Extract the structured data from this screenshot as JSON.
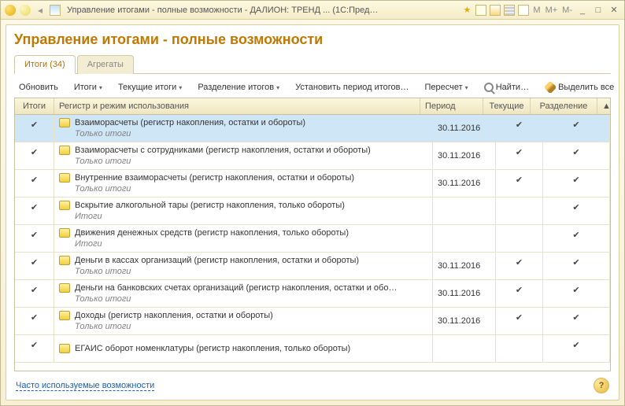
{
  "window_title": "Управление итогами - полные возможности - ДАЛИОН: ТРЕНД ... (1С:Предприятие)",
  "page_title": "Управление итогами - полные возможности",
  "tabs": [
    {
      "label": "Итоги (34)",
      "active": true
    },
    {
      "label": "Агрегаты",
      "active": false
    }
  ],
  "toolbar": {
    "refresh": "Обновить",
    "itogi": "Итоги",
    "current": "Текущие итоги",
    "split": "Разделение итогов",
    "set_period": "Установить период итогов…",
    "recalc": "Пересчет",
    "find": "Найти…",
    "select_all": "Выделить все"
  },
  "headers": {
    "itogi": "Итоги",
    "register": "Регистр и режим использования",
    "period": "Период",
    "current": "Текущие",
    "split": "Разделение"
  },
  "rows": [
    {
      "selected": true,
      "itogi": true,
      "name": "Взаиморасчеты (регистр накопления, остатки и обороты)",
      "mode": "Только итоги",
      "period": "30.11.2016",
      "current": true,
      "split": true
    },
    {
      "selected": false,
      "itogi": true,
      "name": "Взаиморасчеты с сотрудниками (регистр накопления, остатки и обороты)",
      "mode": "Только итоги",
      "period": "30.11.2016",
      "current": true,
      "split": true
    },
    {
      "selected": false,
      "itogi": true,
      "name": "Внутренние взаиморасчеты (регистр накопления, остатки и обороты)",
      "mode": "Только итоги",
      "period": "30.11.2016",
      "current": true,
      "split": true
    },
    {
      "selected": false,
      "itogi": true,
      "name": "Вскрытие алкогольной тары (регистр накопления, только обороты)",
      "mode": "Итоги",
      "period": "",
      "current": false,
      "split": true
    },
    {
      "selected": false,
      "itogi": true,
      "name": "Движения денежных средств (регистр накопления, только обороты)",
      "mode": "Итоги",
      "period": "",
      "current": false,
      "split": true
    },
    {
      "selected": false,
      "itogi": true,
      "name": "Деньги в кассах организаций (регистр накопления, остатки и обороты)",
      "mode": "Только итоги",
      "period": "30.11.2016",
      "current": true,
      "split": true
    },
    {
      "selected": false,
      "itogi": true,
      "name": "Деньги на банковских счетах организаций (регистр накопления, остатки и обо…",
      "mode": "Только итоги",
      "period": "30.11.2016",
      "current": true,
      "split": true
    },
    {
      "selected": false,
      "itogi": true,
      "name": "Доходы (регистр накопления, остатки и обороты)",
      "mode": "Только итоги",
      "period": "30.11.2016",
      "current": true,
      "split": true
    },
    {
      "selected": false,
      "itogi": true,
      "name": "ЕГАИС оборот номенклатуры (регистр накопления, только обороты)",
      "mode": "",
      "period": "",
      "current": false,
      "split": true
    }
  ],
  "footer_link": "Часто используемые возможности",
  "titlebar_right": [
    "M",
    "M+",
    "M-"
  ]
}
